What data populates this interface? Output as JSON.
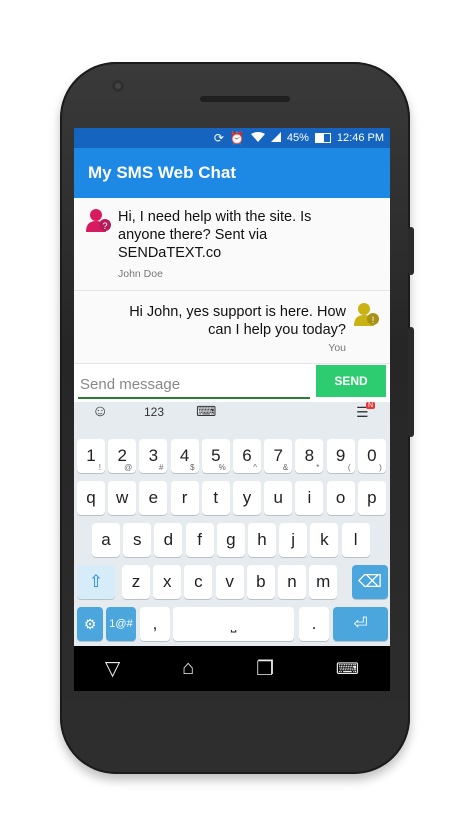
{
  "status_bar": {
    "battery_percent": "45%",
    "time": "12:46 PM",
    "icons": [
      "sync-icon",
      "alarm-icon",
      "wifi-icon",
      "signal-icon",
      "battery-icon"
    ]
  },
  "app": {
    "title": "My SMS Web Chat"
  },
  "messages": [
    {
      "text": "Hi, I need help with the site. Is anyone there? Sent via SENDaTEXT.co",
      "author": "John Doe"
    },
    {
      "text": "Hi John, yes support is here. How can I help you today?",
      "author": "You"
    }
  ],
  "composer": {
    "placeholder": "Send message",
    "send_label": "SEND"
  },
  "keyboard": {
    "toolbar": {
      "numbers_label": "123",
      "badge": "N"
    },
    "row1": [
      {
        "k": "1",
        "s": "!"
      },
      {
        "k": "2",
        "s": "@"
      },
      {
        "k": "3",
        "s": "#"
      },
      {
        "k": "4",
        "s": "$"
      },
      {
        "k": "5",
        "s": "%"
      },
      {
        "k": "6",
        "s": "^"
      },
      {
        "k": "7",
        "s": "&"
      },
      {
        "k": "8",
        "s": "*"
      },
      {
        "k": "9",
        "s": "("
      },
      {
        "k": "0",
        "s": ")"
      }
    ],
    "row2": [
      "q",
      "w",
      "e",
      "r",
      "t",
      "y",
      "u",
      "i",
      "o",
      "p"
    ],
    "row3": [
      "a",
      "s",
      "d",
      "f",
      "g",
      "h",
      "j",
      "k",
      "l"
    ],
    "row4": [
      "z",
      "x",
      "c",
      "v",
      "b",
      "n",
      "m"
    ],
    "row5": {
      "symbols_label": "1@#",
      "comma": ",",
      "period": "."
    }
  }
}
